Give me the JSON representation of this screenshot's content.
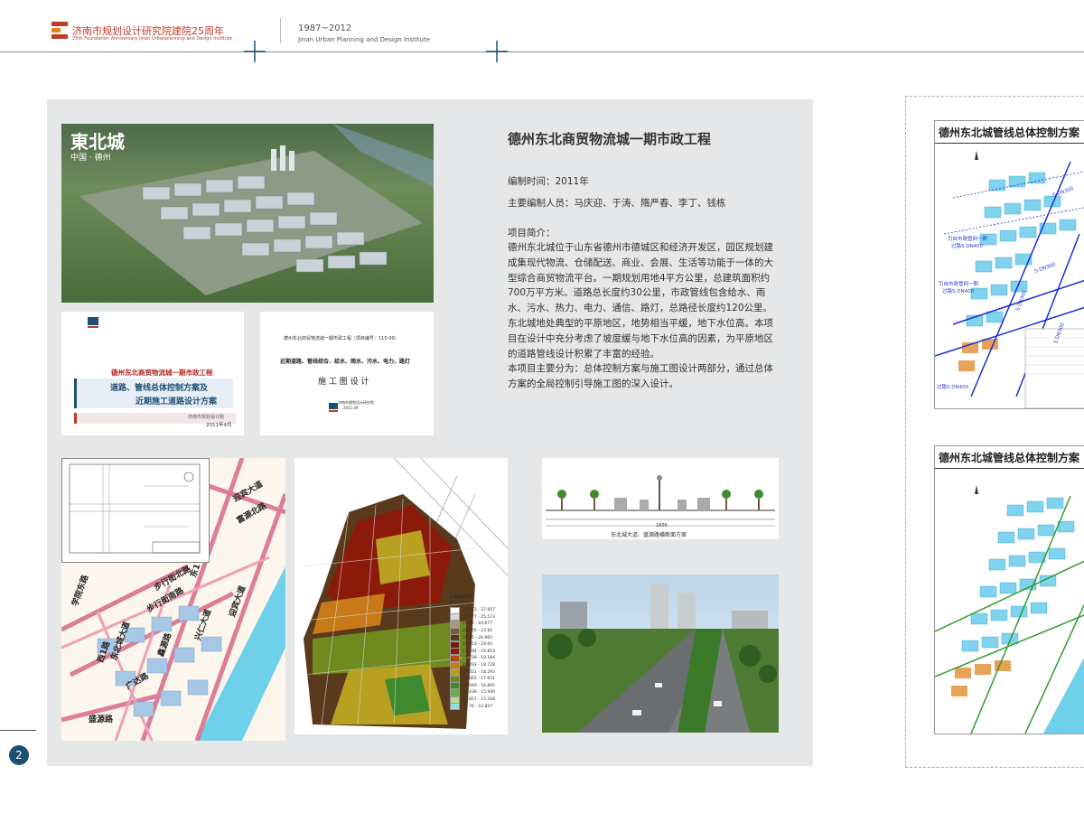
{
  "header": {
    "org_name": "济南市规划设计研究院建院25周年",
    "org_sub": "25th Foundation Anniversary Jinan Urbanplanning and Design Institute",
    "years": "1987~2012",
    "institute_en": "Jinan Urban Planning and Design Institute"
  },
  "colors": {
    "accent": "#1d4f73",
    "panel": "#e6e7e8",
    "brand_red": "#c0392b"
  },
  "aerial": {
    "logo_text": "東北城",
    "logo_sub": "中国 · 德州"
  },
  "cover1": {
    "title": "德州东北商贸物流城一期市政工程",
    "subtitle_line1": "道路、管线总体控制方案及",
    "subtitle_line2": "近期施工道路设计方案",
    "org": "济南市规划设计院",
    "date": "2011年4月"
  },
  "cover2": {
    "line1": "德州东北商贸物流城一期市政工程（项目编号：115-09）",
    "line2": "近期道路、管线综合、给水、雨水、污水、电力、路灯",
    "line3": "施 工 图 设 计",
    "org": "济南市规划设计研究院",
    "date": "2011.09"
  },
  "info": {
    "title": "德州东北商贸物流城一期市政工程",
    "date_line": "编制时间：2011年",
    "staff_line": "主要编制人员：马庆迎、于涛、隋严春、李丁、钱栋",
    "intro_heading": "项目简介：",
    "intro_p1": "德州东北城位于山东省德州市德城区和经济开发区，园区规划建成集现代物流、仓储配送、商业、会展、生活等功能于一体的大型综合商贸物流平台。一期规划用地4平方公里，总建筑面积约700万平方米。道路总长度约30公里，市政管线包含给水、雨水、污水、热力、电力、通信、路灯，总路径长度约120公里。东北城地处典型的平原地区，地势相当平缓，地下水位高。本项目在设计中充分考虑了坡度缓与地下水位高的因素，为平原地区的道路管线设计积累了丰富的经验。",
    "intro_p2": "本项目主要分为：总体控制方案与施工图设计两部分，通过总体方案的全局控制引导施工图的深入设计。"
  },
  "roadmap": {
    "labels": [
      "迎宾大道",
      "富源北路",
      "步行街北路",
      "步行街南路",
      "东1",
      "学院东路",
      "东北城大道",
      "西1路",
      "鑫源路",
      "兴仁大道",
      "迎宾大道",
      "广达路",
      "盛源路"
    ]
  },
  "legend": {
    "title": "Legend",
    "subtitle": "Elevation",
    "items": [
      {
        "range": "25.573 - 27.857",
        "color": "#ffffff"
      },
      {
        "range": "24.677 - 25.573",
        "color": "#d9d9d9"
      },
      {
        "range": "23.82 - 24.677",
        "color": "#a89a8a"
      },
      {
        "range": "20.965 - 23.82",
        "color": "#7b5b3a"
      },
      {
        "range": "19.95 - 20.965",
        "color": "#5a3a1c"
      },
      {
        "range": "19.853 - 19.95",
        "color": "#6b1f10"
      },
      {
        "range": "19.184 - 19.853",
        "color": "#8b1a0a"
      },
      {
        "range": "18.728 - 19.184",
        "color": "#b24a10"
      },
      {
        "range": "18.293 - 18.728",
        "color": "#c97a18"
      },
      {
        "range": "17.651 - 18.293",
        "color": "#b9a020"
      },
      {
        "range": "16.865 - 17.651",
        "color": "#6f8a1e"
      },
      {
        "range": "15.949 - 16.865",
        "color": "#3e8a2c"
      },
      {
        "range": "15.438 - 15.949",
        "color": "#63b04a"
      },
      {
        "range": "12.857 - 15.438",
        "color": "#b9dd8a"
      },
      {
        "range": "11.76 - 12.857",
        "color": "#9ad8e8"
      }
    ]
  },
  "section": {
    "caption": "东北城大道、盛源路横断面方案",
    "total": "1600"
  },
  "sheets": [
    {
      "title": "德州东北城管线总体控制方案",
      "notes": [
        "引自市政管网一期",
        "过路S DN400",
        "引自市政管网一期",
        "过路S DN400",
        "过路S DN400",
        "S DN300",
        "S DN300",
        "S DN300",
        "S DN300"
      ]
    },
    {
      "title": "德州东北城管线总体控制方案"
    }
  ],
  "page": {
    "number": "2"
  }
}
